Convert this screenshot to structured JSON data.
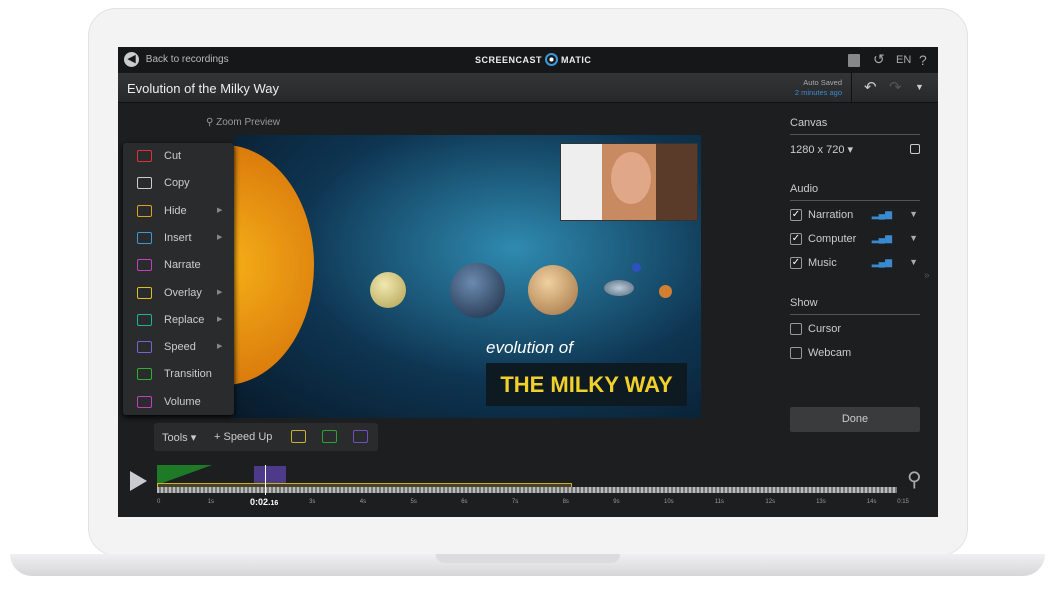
{
  "topbar": {
    "back_label": "Back to recordings",
    "logo_left": "SCREENCAST",
    "logo_right": "MATIC",
    "lang": "EN",
    "help": "?"
  },
  "titlebar": {
    "title": "Evolution of the Milky Way",
    "autosave": "Auto Saved",
    "autosave_time": "2 minutes ago"
  },
  "preview": {
    "zoom_label": "Zoom Preview",
    "overlay_small": "evolution of",
    "overlay_big": "THE MILKY WAY"
  },
  "tools_menu": [
    {
      "label": "Cut",
      "color": "#d33",
      "submenu": false
    },
    {
      "label": "Copy",
      "color": "#ccc",
      "submenu": false
    },
    {
      "label": "Hide",
      "color": "#e0a020",
      "submenu": true
    },
    {
      "label": "Insert",
      "color": "#3a9ad9",
      "submenu": true
    },
    {
      "label": "Narrate",
      "color": "#c040c0",
      "submenu": false
    },
    {
      "label": "Overlay",
      "color": "#e0c020",
      "submenu": true
    },
    {
      "label": "Replace",
      "color": "#20b0a0",
      "submenu": true
    },
    {
      "label": "Speed",
      "color": "#8060d0",
      "submenu": true
    },
    {
      "label": "Transition",
      "color": "#30b030",
      "submenu": false
    },
    {
      "label": "Volume",
      "color": "#c040c0",
      "submenu": false
    }
  ],
  "toolbar": {
    "tools_label": "Tools",
    "speed_up_label": "+ Speed Up",
    "quick_icon_colors": [
      "#c8b030",
      "#30a030",
      "#7050c0"
    ]
  },
  "right_panel": {
    "canvas_heading": "Canvas",
    "canvas_size": "1280 x 720",
    "audio_heading": "Audio",
    "audio": [
      {
        "label": "Narration",
        "checked": true
      },
      {
        "label": "Computer",
        "checked": true
      },
      {
        "label": "Music",
        "checked": true
      }
    ],
    "show_heading": "Show",
    "show": [
      {
        "label": "Cursor",
        "checked": false
      },
      {
        "label": "Webcam",
        "checked": false
      }
    ],
    "done_label": "Done"
  },
  "timeline": {
    "current_time": "0:02.16",
    "current_time_main": "0:02.",
    "current_time_frac": "16",
    "ticks": [
      "0",
      "1s",
      "3s",
      "4s",
      "5s",
      "6s",
      "7s",
      "8s",
      "9s",
      "10s",
      "11s",
      "12s",
      "13s",
      "14s",
      "0:15"
    ],
    "accent": "#c8b030"
  }
}
